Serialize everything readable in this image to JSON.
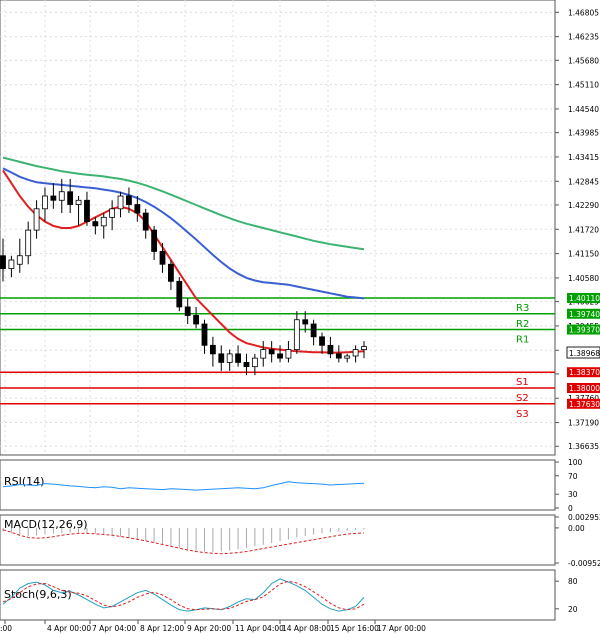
{
  "chart_data": {
    "type": "candlestick",
    "main": {
      "price_ticks": [
        "1.46805",
        "1.46235",
        "1.45680",
        "1.45110",
        "1.44540",
        "1.43985",
        "1.43415",
        "1.42845",
        "1.42290",
        "1.41720",
        "1.41150",
        "1.40580",
        "1.40025",
        "1.39455",
        "1.38885",
        "1.38330",
        "1.37760",
        "1.37190",
        "1.36635"
      ],
      "price_range": [
        1.365,
        1.47
      ],
      "time_labels": [
        ":00",
        "4 Apr 00:00",
        "7 Apr 04:00",
        "8 Apr 12:00",
        "9 Apr 20:00",
        "11 Apr 04:00",
        "14 Apr 08:00",
        "15 Apr 16:00",
        "17 Apr 00:00"
      ],
      "current_price": "1.38968",
      "levels": [
        {
          "label": "R3",
          "value": 1.4011,
          "text": "1.40110",
          "color": "#00a000"
        },
        {
          "label": "R2",
          "value": 1.3974,
          "text": "1.39740",
          "color": "#00a000"
        },
        {
          "label": "R1",
          "value": 1.3937,
          "text": "1.39370",
          "color": "#00a000"
        },
        {
          "label": "S1",
          "value": 1.3837,
          "text": "1.38370",
          "color": "#e00000"
        },
        {
          "label": "S2",
          "value": 1.38,
          "text": "1.38000",
          "color": "#e00000"
        },
        {
          "label": "S3",
          "value": 1.3763,
          "text": "1.37630",
          "color": "#e00000"
        }
      ],
      "candles": [
        [
          1.411,
          1.415,
          1.405,
          1.408
        ],
        [
          1.408,
          1.411,
          1.406,
          1.41
        ],
        [
          1.409,
          1.415,
          1.407,
          1.411
        ],
        [
          1.411,
          1.419,
          1.409,
          1.417
        ],
        [
          1.417,
          1.424,
          1.415,
          1.422
        ],
        [
          1.422,
          1.427,
          1.419,
          1.425
        ],
        [
          1.425,
          1.428,
          1.422,
          1.424
        ],
        [
          1.424,
          1.429,
          1.421,
          1.426
        ],
        [
          1.426,
          1.429,
          1.421,
          1.423
        ],
        [
          1.423,
          1.425,
          1.418,
          1.424
        ],
        [
          1.424,
          1.426,
          1.418,
          1.419
        ],
        [
          1.419,
          1.42,
          1.416,
          1.418
        ],
        [
          1.418,
          1.421,
          1.415,
          1.42
        ],
        [
          1.42,
          1.424,
          1.417,
          1.422
        ],
        [
          1.422,
          1.426,
          1.42,
          1.425
        ],
        [
          1.425,
          1.427,
          1.421,
          1.423
        ],
        [
          1.423,
          1.425,
          1.419,
          1.421
        ],
        [
          1.421,
          1.422,
          1.415,
          1.417
        ],
        [
          1.417,
          1.418,
          1.41,
          1.412
        ],
        [
          1.412,
          1.414,
          1.407,
          1.409
        ],
        [
          1.409,
          1.41,
          1.403,
          1.405
        ],
        [
          1.405,
          1.406,
          1.398,
          1.399
        ],
        [
          1.399,
          1.401,
          1.395,
          1.397
        ],
        [
          1.397,
          1.399,
          1.394,
          1.395
        ],
        [
          1.395,
          1.396,
          1.388,
          1.39
        ],
        [
          1.39,
          1.392,
          1.385,
          1.388
        ],
        [
          1.388,
          1.39,
          1.384,
          1.386
        ],
        [
          1.386,
          1.389,
          1.384,
          1.388
        ],
        [
          1.388,
          1.39,
          1.385,
          1.386
        ],
        [
          1.386,
          1.388,
          1.383,
          1.385
        ],
        [
          1.385,
          1.388,
          1.383,
          1.387
        ],
        [
          1.387,
          1.391,
          1.385,
          1.389
        ],
        [
          1.389,
          1.391,
          1.386,
          1.388
        ],
        [
          1.388,
          1.39,
          1.386,
          1.387
        ],
        [
          1.387,
          1.391,
          1.386,
          1.389
        ],
        [
          1.389,
          1.398,
          1.388,
          1.396
        ],
        [
          1.396,
          1.398,
          1.393,
          1.395
        ],
        [
          1.395,
          1.396,
          1.39,
          1.392
        ],
        [
          1.392,
          1.393,
          1.388,
          1.39
        ],
        [
          1.39,
          1.392,
          1.387,
          1.388
        ],
        [
          1.388,
          1.39,
          1.386,
          1.387
        ],
        [
          1.387,
          1.388,
          1.386,
          1.3875
        ],
        [
          1.3875,
          1.39,
          1.386,
          1.389
        ],
        [
          1.389,
          1.391,
          1.387,
          1.3897
        ]
      ],
      "ma_red": [
        1.431,
        1.428,
        1.425,
        1.4225,
        1.4205,
        1.419,
        1.418,
        1.4175,
        1.4175,
        1.418,
        1.419,
        1.42,
        1.421,
        1.422,
        1.4225,
        1.422,
        1.421,
        1.419,
        1.416,
        1.413,
        1.41,
        1.407,
        1.404,
        1.401,
        1.399,
        1.397,
        1.395,
        1.393,
        1.3915,
        1.3905,
        1.39,
        1.3895,
        1.3892,
        1.389,
        1.3888,
        1.3886,
        1.3885,
        1.3884,
        1.3884,
        1.3883,
        1.3883,
        1.3884,
        1.3885,
        1.3886
      ],
      "ma_blue": [
        1.4315,
        1.4305,
        1.4295,
        1.4288,
        1.4282,
        1.428,
        1.4278,
        1.4276,
        1.4274,
        1.4272,
        1.427,
        1.4268,
        1.4265,
        1.4262,
        1.4258,
        1.4252,
        1.4245,
        1.4236,
        1.4225,
        1.4212,
        1.4198,
        1.4182,
        1.4165,
        1.4148,
        1.413,
        1.4112,
        1.4095,
        1.408,
        1.4068,
        1.4058,
        1.4052,
        1.4048,
        1.4046,
        1.4044,
        1.4042,
        1.4038,
        1.4034,
        1.403,
        1.4026,
        1.4022,
        1.4018,
        1.4014,
        1.4012,
        1.401
      ],
      "ma_green": [
        1.434,
        1.4335,
        1.433,
        1.4325,
        1.432,
        1.4316,
        1.4312,
        1.4308,
        1.4305,
        1.4302,
        1.43,
        1.4298,
        1.4296,
        1.4293,
        1.429,
        1.4286,
        1.4281,
        1.4275,
        1.4268,
        1.4261,
        1.4253,
        1.4245,
        1.4237,
        1.4229,
        1.4221,
        1.4213,
        1.4205,
        1.4198,
        1.4191,
        1.4185,
        1.418,
        1.4175,
        1.417,
        1.4165,
        1.416,
        1.4155,
        1.415,
        1.4145,
        1.4141,
        1.4137,
        1.4134,
        1.4131,
        1.4128,
        1.4125
      ]
    },
    "rsi": {
      "label": "RSI(14)",
      "range": [
        0,
        100
      ],
      "ticks": [
        "100",
        "70",
        "30",
        "0"
      ],
      "values": [
        46,
        48,
        51,
        50,
        49,
        53,
        52,
        50,
        48,
        47,
        45,
        44,
        46,
        45,
        42,
        44,
        43,
        42,
        41,
        40,
        42,
        41,
        40,
        39,
        40,
        41,
        42,
        43,
        44,
        43,
        42,
        44,
        49,
        53,
        57,
        55,
        54,
        53,
        52,
        50,
        51,
        52,
        53,
        54
      ]
    },
    "macd": {
      "label": "MACD(12,26,9)",
      "range": [
        -0.009528,
        0.002952
      ],
      "ticks": [
        "0.002952",
        "0.00",
        "-0.009528"
      ],
      "histogram": [
        -0.001,
        -0.0015,
        -0.002,
        -0.0022,
        -0.0021,
        -0.0018,
        -0.0016,
        -0.0014,
        -0.0013,
        -0.0013,
        -0.0014,
        -0.0016,
        -0.0018,
        -0.002,
        -0.0023,
        -0.0027,
        -0.0031,
        -0.0035,
        -0.004,
        -0.0045,
        -0.005,
        -0.0055,
        -0.0059,
        -0.0062,
        -0.0064,
        -0.0065,
        -0.0064,
        -0.0062,
        -0.0058,
        -0.0054,
        -0.005,
        -0.0046,
        -0.0041,
        -0.0036,
        -0.0031,
        -0.0026,
        -0.0022,
        -0.0018,
        -0.0015,
        -0.0012,
        -0.001,
        -0.0008,
        -0.0006,
        -0.0005
      ],
      "signal": [
        -0.0005,
        -0.0012,
        -0.002,
        -0.0026,
        -0.0028,
        -0.0027,
        -0.0024,
        -0.002,
        -0.0017,
        -0.0015,
        -0.0015,
        -0.0016,
        -0.0018,
        -0.002,
        -0.0023,
        -0.0027,
        -0.0031,
        -0.0035,
        -0.004,
        -0.0045,
        -0.005,
        -0.0055,
        -0.006,
        -0.0064,
        -0.0067,
        -0.0069,
        -0.007,
        -0.0069,
        -0.0067,
        -0.0064,
        -0.006,
        -0.0056,
        -0.0052,
        -0.0048,
        -0.0044,
        -0.004,
        -0.0036,
        -0.0032,
        -0.0028,
        -0.0024,
        -0.002,
        -0.0017,
        -0.0015,
        -0.0014
      ]
    },
    "stoch": {
      "label": "Stoch(9,6,3)",
      "range": [
        0,
        100
      ],
      "ticks": [
        "80",
        "20"
      ],
      "k": [
        30,
        45,
        65,
        75,
        78,
        72,
        60,
        55,
        58,
        50,
        40,
        30,
        22,
        25,
        35,
        45,
        55,
        60,
        52,
        40,
        28,
        18,
        15,
        18,
        22,
        20,
        18,
        25,
        35,
        42,
        40,
        55,
        75,
        85,
        78,
        70,
        60,
        45,
        30,
        20,
        15,
        18,
        25,
        45
      ],
      "d": [
        35,
        42,
        55,
        68,
        74,
        75,
        68,
        60,
        56,
        54,
        48,
        38,
        28,
        24,
        28,
        35,
        45,
        52,
        56,
        50,
        40,
        28,
        20,
        18,
        19,
        20,
        19,
        21,
        28,
        36,
        40,
        46,
        60,
        74,
        80,
        76,
        68,
        57,
        45,
        32,
        22,
        18,
        20,
        30
      ]
    }
  }
}
